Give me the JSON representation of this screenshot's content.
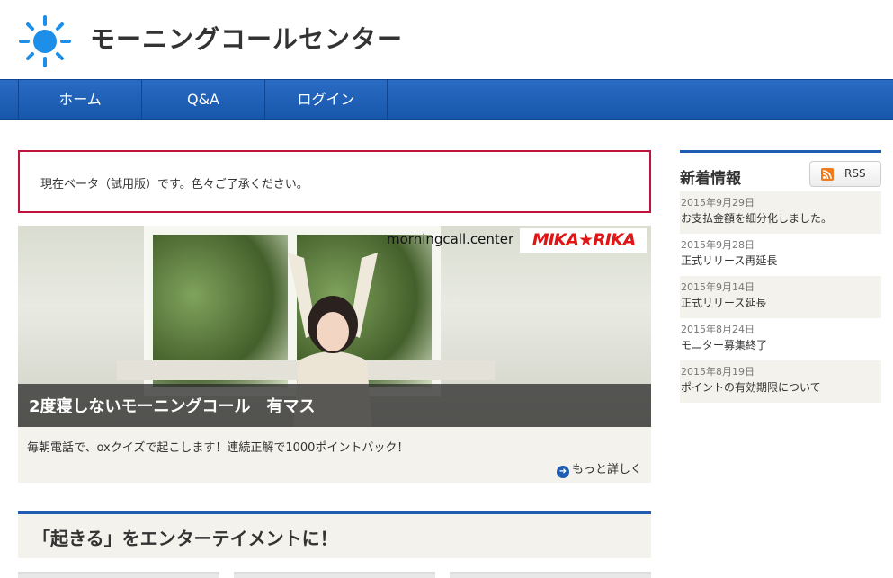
{
  "site": {
    "title": "モーニングコールセンター",
    "logo_icon": "sun-icon"
  },
  "nav": {
    "items": [
      {
        "label": "ホーム"
      },
      {
        "label": "Q&A"
      },
      {
        "label": "ログイン"
      }
    ]
  },
  "notice": {
    "text": "現在ベータ（試用版）です。色々ご了承ください。"
  },
  "hero": {
    "site_text": "morningcall.center",
    "brand_logo": "MIKA★RIKA",
    "caption": "2度寝しないモーニングコール　有マス",
    "description": "毎朝電話で、oxクイズで起こします！連続正解で1000ポイントバック！",
    "more_label": "もっと詳しく"
  },
  "section": {
    "title": "「起きる」をエンターテイメントに！"
  },
  "sidebar": {
    "title": "新着情報",
    "rss_label": "RSS",
    "news": [
      {
        "date": "2015年9月29日",
        "title": "お支払金額を細分化しました。"
      },
      {
        "date": "2015年9月28日",
        "title": "正式リリース再延長"
      },
      {
        "date": "2015年9月14日",
        "title": "正式リリース延長"
      },
      {
        "date": "2015年8月24日",
        "title": "モニター募集終了"
      },
      {
        "date": "2015年8月19日",
        "title": "ポイントの有効期限について"
      }
    ]
  },
  "colors": {
    "accent": "#1f5db5",
    "notice_border": "#c0143c",
    "logo": "#1e8fe8",
    "rss": "#f07b1c"
  }
}
